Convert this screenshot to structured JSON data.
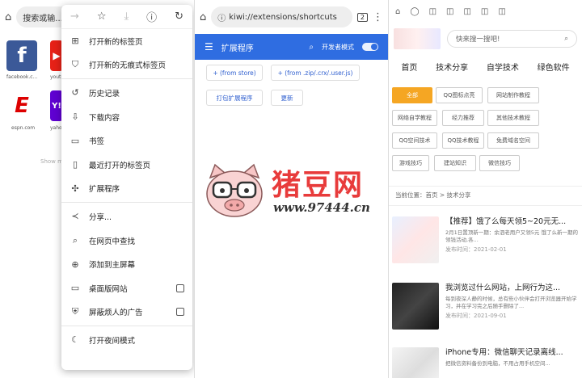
{
  "p1": {
    "search_text": "搜索或输...",
    "tiles": [
      {
        "label": "facebook.c...",
        "glyph": "f",
        "color": "#3b5998"
      },
      {
        "label": "youtu...",
        "glyph": "▶",
        "color": "#e62117"
      },
      {
        "label": "espn.com",
        "glyph": "E",
        "color": "#d00"
      },
      {
        "label": "yaho...",
        "glyph": "Y!",
        "color": "#5f01d1"
      }
    ],
    "show_more": "Show m",
    "menu": {
      "items": [
        {
          "label": "打开新的标签页",
          "icon": "plus-box-icon",
          "glyph": "⊞"
        },
        {
          "label": "打开新的无痕式标签页",
          "icon": "incognito-icon",
          "glyph": "⛉"
        },
        {
          "label": "历史记录",
          "icon": "history-icon",
          "glyph": "↺"
        },
        {
          "label": "下载内容",
          "icon": "download-icon",
          "glyph": "⇩"
        },
        {
          "label": "书签",
          "icon": "bookmark-icon",
          "glyph": "▭"
        },
        {
          "label": "最近打开的标签页",
          "icon": "recent-tabs-icon",
          "glyph": "▯"
        },
        {
          "label": "扩展程序",
          "icon": "puzzle-icon",
          "glyph": "✣"
        },
        {
          "label": "分享...",
          "icon": "share-icon",
          "glyph": "≺"
        },
        {
          "label": "在网页中查找",
          "icon": "find-icon",
          "glyph": "⌕"
        },
        {
          "label": "添加到主屏幕",
          "icon": "add-home-icon",
          "glyph": "⊕"
        },
        {
          "label": "桌面版网站",
          "icon": "desktop-icon",
          "glyph": "▭",
          "checkbox": true
        },
        {
          "label": "屏蔽烦人的广告",
          "icon": "shield-icon",
          "glyph": "⛨",
          "checkbox": true
        },
        {
          "label": "打开夜间模式",
          "icon": "moon-icon",
          "glyph": "☾"
        }
      ]
    }
  },
  "p2": {
    "url": "kiwi://extensions/shortcuts",
    "tab_count": "2",
    "title": "扩展程序",
    "dev_mode": "开发者模式",
    "buttons": [
      "+ (from store)",
      "+ (from .zip/.crx/.user.js)",
      "打包扩展程序",
      "更新"
    ]
  },
  "p3": {
    "search_placeholder": "快来搜一搜吧!",
    "nav": [
      "首页",
      "技术分享",
      "自学技术",
      "绿色软件"
    ],
    "tags": [
      "全部",
      "QQ图标点亮",
      "网站制作教程",
      "网络自学教程",
      "经力推荐",
      "其他技术教程",
      "QQ空间技术",
      "QQ技术教程",
      "免费域名空间",
      "游戏技巧",
      "建站知识",
      "微信技巧"
    ],
    "breadcrumb": "当前位置：首页 > 技术分享",
    "articles": [
      {
        "title": "【推荐】饿了么每天领5~20元无...",
        "desc": "2月1日置顶新一期：余泗老用户又领5元 饿了么新一期的领钱活动,各...",
        "date": "发布时间：2021-02-01"
      },
      {
        "title": "我浏览过什么网站，上网行为这...",
        "desc": "每到夜深人静的时候，总有些小伙伴会打开浏览器开始学习，并在学习完之后随手删除了...",
        "date": "发布时间：2021-09-01"
      },
      {
        "title": "iPhone专用：微信聊天记录离线...",
        "desc": "把微信资料备份到电脑，不用占用手机空间...",
        "date": ""
      }
    ]
  },
  "watermark": {
    "title": "猪豆网",
    "url": "www.97444.cn"
  }
}
